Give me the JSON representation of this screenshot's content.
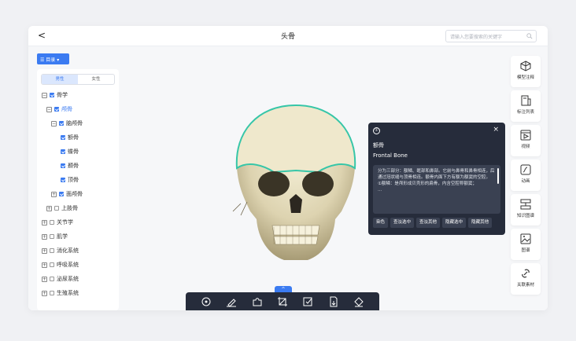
{
  "header": {
    "back_glyph": "<",
    "title": "头骨",
    "search_placeholder": "请输入您要搜索的关键字"
  },
  "sidebar": {
    "directory_label": "目录",
    "gender_tabs": [
      "男性",
      "女性"
    ],
    "tree": [
      {
        "label": "骨学",
        "level": 0,
        "expanded": true,
        "checked": true,
        "highlight": false
      },
      {
        "label": "颅骨",
        "level": 1,
        "expanded": true,
        "checked": true,
        "highlight": true
      },
      {
        "label": "脑颅骨",
        "level": 2,
        "expanded": true,
        "checked": true,
        "highlight": false
      },
      {
        "label": "额骨",
        "level": 3,
        "checked": true,
        "highlight": false
      },
      {
        "label": "蝶骨",
        "level": 3,
        "checked": true,
        "highlight": false
      },
      {
        "label": "颞骨",
        "level": 3,
        "checked": true,
        "highlight": false
      },
      {
        "label": "顶骨",
        "level": 3,
        "checked": true,
        "highlight": false
      },
      {
        "label": "面颅骨",
        "level": 2,
        "expanded": false,
        "checked": true,
        "highlight": false
      },
      {
        "label": "上肢骨",
        "level": 1,
        "expanded": false,
        "checked": false,
        "highlight": false
      },
      {
        "label": "关节学",
        "level": 0,
        "expanded": false,
        "checked": false,
        "highlight": false
      },
      {
        "label": "肌学",
        "level": 0,
        "expanded": false,
        "checked": false,
        "highlight": false
      },
      {
        "label": "消化系统",
        "level": 0,
        "expanded": false,
        "checked": false,
        "highlight": false
      },
      {
        "label": "呼吸系统",
        "level": 0,
        "expanded": false,
        "checked": false,
        "highlight": false
      },
      {
        "label": "泌尿系统",
        "level": 0,
        "expanded": false,
        "checked": false,
        "highlight": false
      },
      {
        "label": "生殖系统",
        "level": 0,
        "expanded": false,
        "checked": false,
        "highlight": false
      }
    ]
  },
  "info_card": {
    "number": "①",
    "close_glyph": "×",
    "name_cn": "额骨",
    "name_en": "Frontal Bone",
    "description": "分为三部分：额鳞、眶部和鼻部。它前与鼻骨和鼻骨相连，后通过冠状缝与顶骨相连。额骨内面下方有额为额窦的空腔。\n①额鳞：是颅形成贝壳形的扁骨，内含空腔称额窦；\n…",
    "actions": [
      "染色",
      "查淡选中",
      "查淡其他",
      "隐藏选中",
      "隐藏其他"
    ]
  },
  "right_tools": [
    {
      "label": "模型注释",
      "icon": "cube-icon"
    },
    {
      "label": "标注列表",
      "icon": "annotation-list-icon"
    },
    {
      "label": "视频",
      "icon": "video-icon"
    },
    {
      "label": "动画",
      "icon": "animation-icon"
    },
    {
      "label": "知识图谱",
      "icon": "knowledge-graph-icon"
    },
    {
      "label": "图谱",
      "icon": "image-atlas-icon"
    },
    {
      "label": "关联素材",
      "icon": "link-icon"
    }
  ],
  "bottom_tools": [
    "rotate-icon",
    "pen-icon",
    "puzzle-icon",
    "crop-icon",
    "checklist-icon",
    "export-icon",
    "paint-bucket-icon"
  ],
  "colors": {
    "accent": "#3b7bf1",
    "dark_panel": "#262c3b",
    "highlight_outline": "#36c6a8",
    "bone": "#e8dfc0"
  }
}
